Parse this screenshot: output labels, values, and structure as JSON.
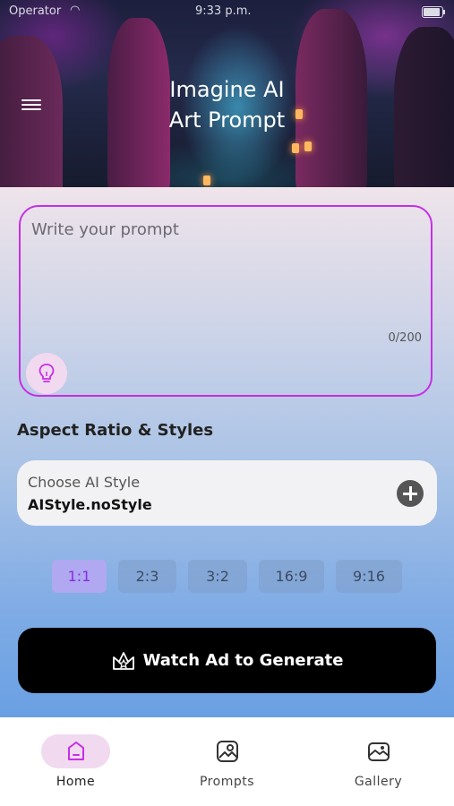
{
  "status_bar": {
    "carrier": "Operator",
    "time": "9:33 p.m."
  },
  "header": {
    "title": "Imagine AI\nArt Prompt"
  },
  "prompt": {
    "placeholder": "Write your prompt",
    "value": "",
    "counter": "0/200"
  },
  "section_title": "Aspect Ratio & Styles",
  "style_picker": {
    "label": "Choose AI Style",
    "value": "AIStyle.noStyle"
  },
  "aspect_ratios": [
    "1:1",
    "2:3",
    "3:2",
    "16:9",
    "9:16"
  ],
  "selected_ratio": "1:1",
  "generate_button": {
    "label": "Watch Ad to Generate"
  },
  "tabs": [
    {
      "label": "Home",
      "icon": "home-icon"
    },
    {
      "label": "Prompts",
      "icon": "prompts-icon"
    },
    {
      "label": "Gallery",
      "icon": "gallery-icon"
    }
  ],
  "colors": {
    "accent": "#c62fe6",
    "accent_soft": "#f1d9f0",
    "button": "#000000"
  }
}
